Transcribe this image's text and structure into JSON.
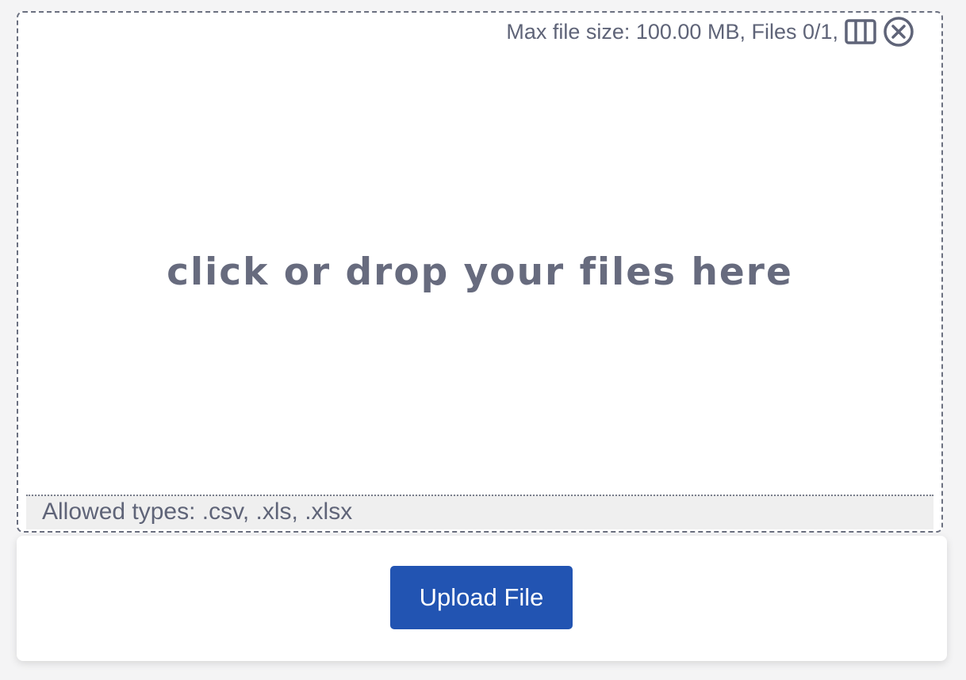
{
  "dropzone": {
    "info_text": "Max file size: 100.00 MB, Files 0/1,",
    "columns_icon": "columns-icon",
    "clear_icon": "circle-x-icon",
    "prompt": "click or drop your files here",
    "allowed_types": "Allowed types: .csv, .xls, .xlsx"
  },
  "footer": {
    "upload_label": "Upload File"
  },
  "colors": {
    "text_muted": "#5f6478",
    "primary": "#2254b2",
    "allowed_bg": "#efefef",
    "page_bg": "#f4f4f5"
  }
}
